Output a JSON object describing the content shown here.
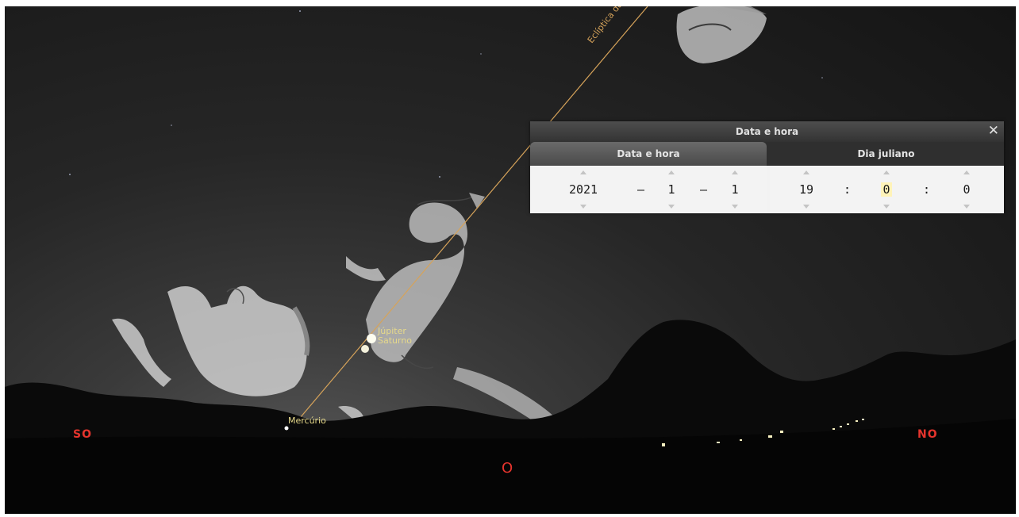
{
  "sky": {
    "ecliptic_label": "Eclíptica da D",
    "planets": [
      {
        "name": "Júpiter"
      },
      {
        "name": "Saturno"
      },
      {
        "name": "Mercúrio"
      }
    ],
    "cardinals": {
      "southwest": "SO",
      "west": "O",
      "northwest": "NO"
    },
    "colors": {
      "cardinal": "#e5342d",
      "planet_label": "#e6d98a",
      "ecliptic": "#d6a35a"
    }
  },
  "dialog": {
    "title": "Data e hora",
    "close_icon": "close-icon",
    "tabs": [
      {
        "label": "Data e hora",
        "active": true
      },
      {
        "label": "Dia juliano",
        "active": false
      }
    ],
    "date": {
      "year": "2021",
      "month": "1",
      "day": "1",
      "separator": "–"
    },
    "time": {
      "hour": "19",
      "minute": "0",
      "second": "0",
      "separator": ":"
    }
  }
}
